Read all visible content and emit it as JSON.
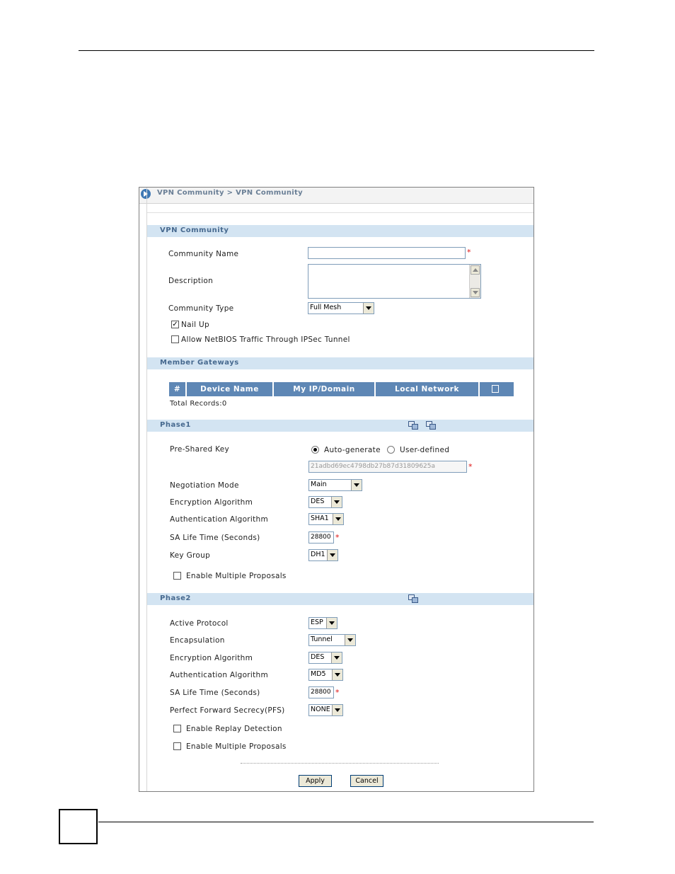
{
  "breadcrumb": "VPN Community > VPN Community",
  "sections": {
    "community": "VPN Community",
    "member_gateways": "Member Gateways",
    "phase1": "Phase1",
    "phase2": "Phase2"
  },
  "community": {
    "name_label": "Community Name",
    "name_value": "",
    "description_label": "Description",
    "description_value": "",
    "type_label": "Community Type",
    "type_value": "Full Mesh",
    "nail_up_label": "Nail Up",
    "nail_up_checked": true,
    "netbios_label": "Allow NetBIOS Traffic Through IPSec Tunnel",
    "netbios_checked": false
  },
  "member_gateways": {
    "columns": [
      "#",
      "Device Name",
      "My IP/Domain",
      "Local Network"
    ],
    "total_records": "Total Records:0"
  },
  "phase1": {
    "psk_label": "Pre-Shared Key",
    "psk_auto_label": "Auto-generate",
    "psk_user_label": "User-defined",
    "psk_selected": "Auto-generate",
    "psk_value": "21adbd69ec4798db27b87d31809625a",
    "negotiation_label": "Negotiation Mode",
    "negotiation_value": "Main",
    "encryption_label": "Encryption Algorithm",
    "encryption_value": "DES",
    "auth_label": "Authentication Algorithm",
    "auth_value": "SHA1",
    "sa_label": "SA Life Time (Seconds)",
    "sa_value": "28800",
    "keygroup_label": "Key Group",
    "keygroup_value": "DH1",
    "multi_label": "Enable Multiple Proposals"
  },
  "phase2": {
    "protocol_label": "Active Protocol",
    "protocol_value": "ESP",
    "encap_label": "Encapsulation",
    "encap_value": "Tunnel",
    "encryption_label": "Encryption Algorithm",
    "encryption_value": "DES",
    "auth_label": "Authentication Algorithm",
    "auth_value": "MD5",
    "sa_label": "SA Life Time (Seconds)",
    "sa_value": "28800",
    "pfs_label": "Perfect Forward Secrecy(PFS)",
    "pfs_value": "NONE",
    "replay_label": "Enable Replay Detection",
    "multi_label": "Enable Multiple Proposals"
  },
  "buttons": {
    "apply": "Apply",
    "cancel": "Cancel"
  },
  "required_mark": "*",
  "icons": [
    "back-arrow-icon",
    "add-gateway-icon",
    "phase1-proposal-icon",
    "phase1-advanced-icon",
    "phase2-advanced-icon"
  ],
  "colors": {
    "section_bg": "#d3e4f2",
    "section_text": "#46698f",
    "table_header": "#5e87b5",
    "required": "#dd1111"
  }
}
